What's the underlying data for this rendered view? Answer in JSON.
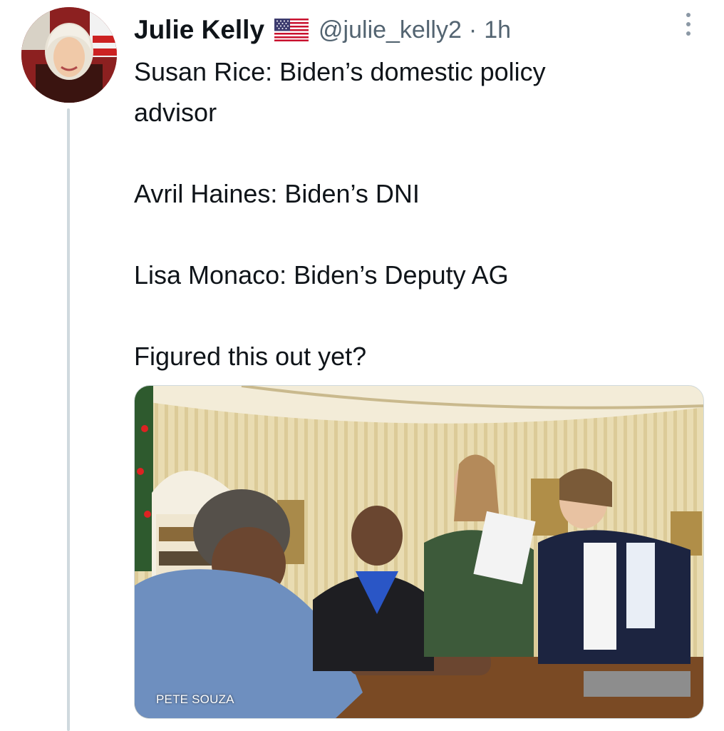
{
  "tweet": {
    "author": {
      "display_name": "Julie Kelly",
      "handle": "@julie_kelly2",
      "flag_icon": "us-flag-icon"
    },
    "separator": "·",
    "timestamp": "1h",
    "more_icon": "more-vertical-icon",
    "text": "Susan Rice: Biden’s domestic policy\nadvisor\n\nAvril Haines: Biden’s DNI\n\nLisa Monaco: Biden’s Deputy AG\n\nFigured this out yet?",
    "media": {
      "credit": "PETE SOUZA"
    }
  },
  "colors": {
    "text_primary": "#0f1419",
    "text_secondary": "#536471",
    "thread_line": "#cfd9de"
  }
}
